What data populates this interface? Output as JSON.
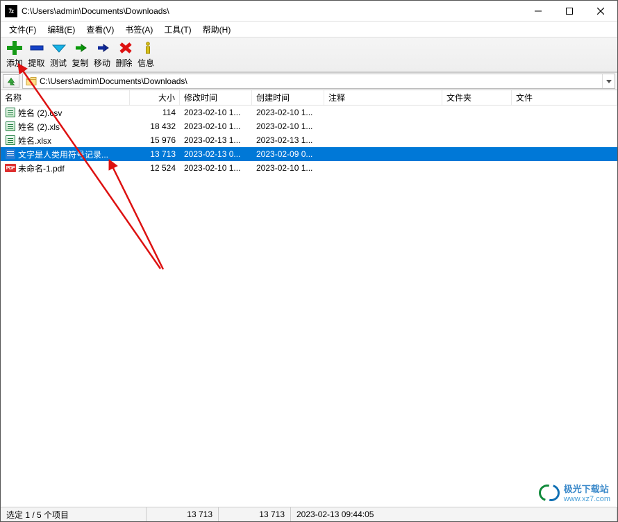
{
  "title": "C:\\Users\\admin\\Documents\\Downloads\\",
  "menu": [
    "文件(F)",
    "编辑(E)",
    "查看(V)",
    "书签(A)",
    "工具(T)",
    "帮助(H)"
  ],
  "toolbar_labels": [
    "添加",
    "提取",
    "测试",
    "复制",
    "移动",
    "删除",
    "信息"
  ],
  "path": "C:\\Users\\admin\\Documents\\Downloads\\",
  "columns": {
    "name": "名称",
    "size": "大小",
    "modified": "修改时间",
    "created": "创建时间",
    "comment": "注释",
    "folder": "文件夹",
    "file": "文件"
  },
  "rows": [
    {
      "icon": "csv",
      "name": "姓名 (2).csv",
      "size": "114",
      "modified": "2023-02-10 1...",
      "created": "2023-02-10 1...",
      "selected": false
    },
    {
      "icon": "xls",
      "name": "姓名 (2).xls",
      "size": "18 432",
      "modified": "2023-02-10 1...",
      "created": "2023-02-10 1...",
      "selected": false
    },
    {
      "icon": "xlsx",
      "name": "姓名.xlsx",
      "size": "15 976",
      "modified": "2023-02-13 1...",
      "created": "2023-02-13 1...",
      "selected": false
    },
    {
      "icon": "doc",
      "name": "文字是人类用符号记录...",
      "size": "13 713",
      "modified": "2023-02-13 0...",
      "created": "2023-02-09 0...",
      "selected": true
    },
    {
      "icon": "pdf",
      "name": "未命名-1.pdf",
      "size": "12 524",
      "modified": "2023-02-10 1...",
      "created": "2023-02-10 1...",
      "selected": false
    }
  ],
  "status": {
    "selection": "选定 1 / 5 个项目",
    "size1": "13 713",
    "size2": "13 713",
    "datetime": "2023-02-13 09:44:05"
  },
  "watermark": {
    "line1": "极光下载站",
    "line2": "www.xz7.com"
  }
}
